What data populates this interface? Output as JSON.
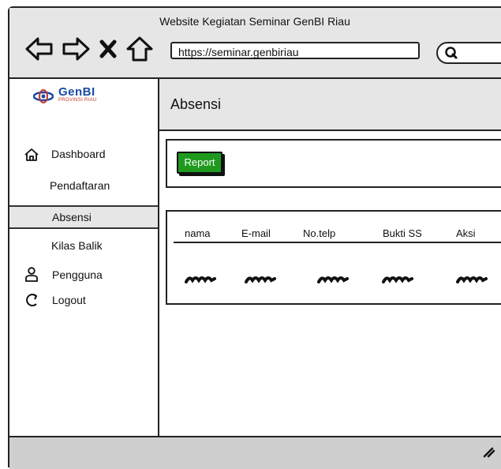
{
  "window": {
    "title": "Website Kegiatan Seminar GenBI Riau",
    "url": "https://seminar.genbiriau"
  },
  "logo": {
    "main": "GenBI",
    "sub": "PROVINSI RIAU"
  },
  "sidebar": {
    "items": [
      {
        "label": "Dashboard",
        "icon": "home-icon"
      },
      {
        "label": "Pendaftaran",
        "icon": ""
      },
      {
        "label": "Absensi",
        "icon": "",
        "active": true
      },
      {
        "label": "Kilas Balik",
        "icon": ""
      },
      {
        "label": "Pengguna",
        "icon": "user-icon"
      },
      {
        "label": "Logout",
        "icon": "logout-icon"
      }
    ]
  },
  "header": {
    "title": "Absensi"
  },
  "toolbar": {
    "report_label": "Report"
  },
  "table": {
    "columns": [
      "nama",
      "E-mail",
      "No.telp",
      "Bukti SS",
      "Aksi"
    ]
  },
  "colors": {
    "accent_green": "#1f9a1f",
    "chrome_gray": "#e6e6e6",
    "logo_blue": "#1a4aa8",
    "logo_red": "#c0392b"
  }
}
